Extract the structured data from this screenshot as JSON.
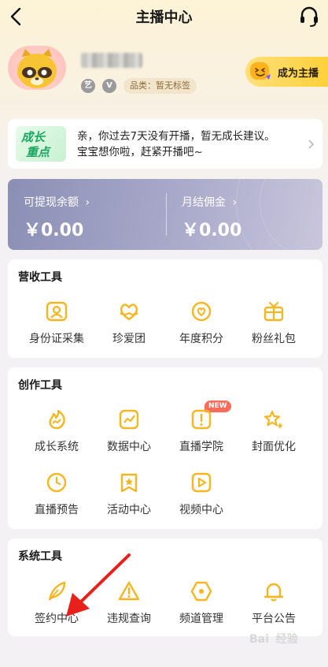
{
  "header": {
    "title": "主播中心"
  },
  "profile": {
    "badge_1": "艺",
    "badge_2": "V",
    "category": "品类：暂无标签",
    "become_anchor_label": "成为主播"
  },
  "growth": {
    "tag_line1": "成长",
    "tag_line2": "重点",
    "line1": "亲，你过去7天没有开播，暂无成长建议。",
    "line2": "宝宝想你啦，赶紧开播吧~"
  },
  "balance": {
    "withdrawable_label": "可提现余额",
    "withdrawable_value": "￥0.00",
    "monthly_label": "月结佣金",
    "monthly_value": "￥0.00"
  },
  "revenue_tools": {
    "title": "营收工具",
    "items": [
      {
        "label": "身份证采集",
        "icon": "id-card-icon"
      },
      {
        "label": "珍爱团",
        "icon": "heart-hands-icon"
      },
      {
        "label": "年度积分",
        "icon": "badge-heart-icon"
      },
      {
        "label": "粉丝礼包",
        "icon": "gift-box-icon"
      }
    ]
  },
  "creation_tools": {
    "title": "创作工具",
    "new_badge": "NEW",
    "items": [
      {
        "label": "成长系统",
        "icon": "flame-chart-icon"
      },
      {
        "label": "数据中心",
        "icon": "line-chart-icon"
      },
      {
        "label": "直播学院",
        "icon": "alert-square-icon"
      },
      {
        "label": "封面优化",
        "icon": "sparkle-star-icon"
      },
      {
        "label": "直播预告",
        "icon": "clock-icon"
      },
      {
        "label": "活动中心",
        "icon": "star-bookmark-icon"
      },
      {
        "label": "视频中心",
        "icon": "play-square-icon"
      }
    ]
  },
  "system_tools": {
    "title": "系统工具",
    "items": [
      {
        "label": "签约中心",
        "icon": "feather-pen-icon"
      },
      {
        "label": "违规查询",
        "icon": "warning-triangle-icon"
      },
      {
        "label": "频道管理",
        "icon": "hexagon-icon"
      },
      {
        "label": "平台公告",
        "icon": "bell-icon"
      }
    ]
  },
  "watermark": {
    "line1": "Bai",
    "line2": "经验"
  },
  "colors": {
    "accent": "#f5b622",
    "badge_red": "#ff6b5b",
    "balance_bg": "#9b9dc0"
  }
}
